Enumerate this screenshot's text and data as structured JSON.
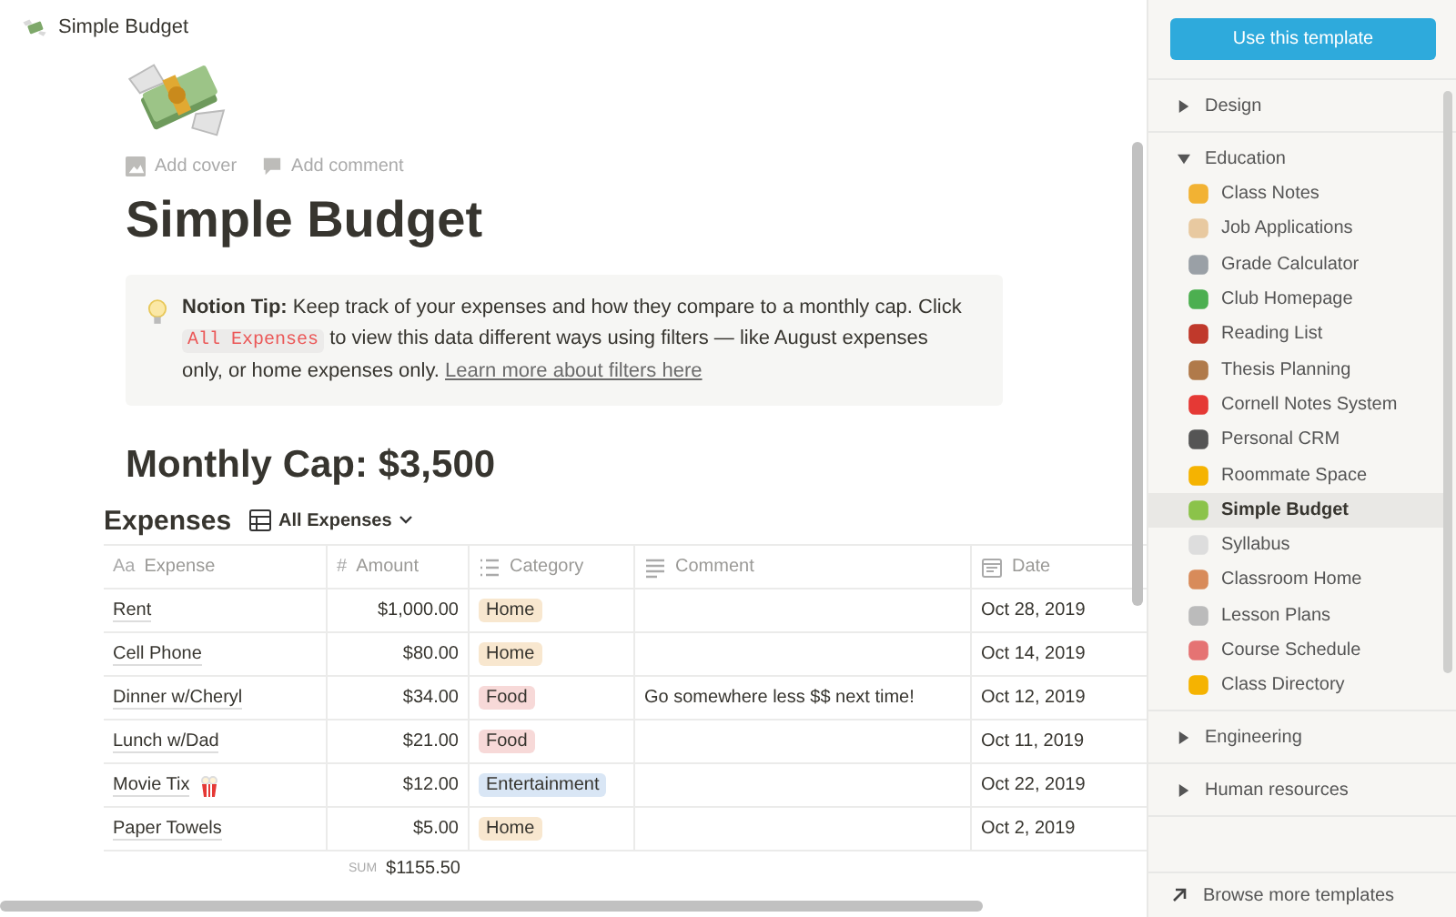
{
  "breadcrumb": {
    "title": "Simple Budget"
  },
  "page_actions": [
    {
      "label": "Add cover",
      "kind": "image"
    },
    {
      "label": "Add comment",
      "kind": "comment"
    }
  ],
  "title": "Simple Budget",
  "callout": {
    "label": "Notion Tip:",
    "text_before": "Keep track of your expenses and how they compare to a monthly cap. Click",
    "code": "All Expenses",
    "text_after": "to view this data different ways using filters — like August expenses only, or home expenses only.",
    "link": "Learn more about filters here"
  },
  "heading": "Monthly Cap: $3,500",
  "database": {
    "title": "Expenses",
    "view": "All Expenses",
    "columns": [
      {
        "label": "Expense",
        "kind": "title",
        "glyph": "Aa"
      },
      {
        "label": "Amount",
        "kind": "number",
        "glyph": "#"
      },
      {
        "label": "Category",
        "kind": "select"
      },
      {
        "label": "Comment",
        "kind": "text"
      },
      {
        "label": "Date",
        "kind": "date"
      }
    ],
    "rows": [
      {
        "expense": "Rent",
        "amount": "$1,000.00",
        "category": "Home",
        "color": "#f8e7cf",
        "comment": "",
        "date": "Oct 28, 2019"
      },
      {
        "expense": "Cell Phone",
        "amount": "$80.00",
        "category": "Home",
        "color": "#f8e7cf",
        "comment": "",
        "date": "Oct 14, 2019"
      },
      {
        "expense": "Dinner w/Cheryl",
        "amount": "$34.00",
        "category": "Food",
        "color": "#f7d9d8",
        "comment": "Go somewhere less $$ next time!",
        "date": "Oct 12, 2019"
      },
      {
        "expense": "Lunch w/Dad",
        "amount": "$21.00",
        "category": "Food",
        "color": "#f7d9d8",
        "comment": "",
        "date": "Oct 11, 2019"
      },
      {
        "expense": "Movie Tix",
        "popcorn": true,
        "amount": "$12.00",
        "category": "Entertainment",
        "color": "#d9e6f5",
        "comment": "",
        "date": "Oct 22, 2019"
      },
      {
        "expense": "Paper Towels",
        "amount": "$5.00",
        "category": "Home",
        "color": "#f8e7cf",
        "comment": "",
        "date": "Oct 2, 2019"
      }
    ],
    "sum_label": "SUM",
    "sum": "$1155.50"
  },
  "sidebar": {
    "button": "Use this template",
    "sections": [
      {
        "label": "Design",
        "expanded": false
      },
      {
        "label": "Education",
        "expanded": true,
        "items": [
          {
            "label": "Class Notes",
            "selected": false
          },
          {
            "label": "Job Applications",
            "selected": false
          },
          {
            "label": "Grade Calculator",
            "selected": false
          },
          {
            "label": "Club Homepage",
            "selected": false
          },
          {
            "label": "Reading List",
            "selected": false
          },
          {
            "label": "Thesis Planning",
            "selected": false
          },
          {
            "label": "Cornell Notes System",
            "selected": false
          },
          {
            "label": "Personal CRM",
            "selected": false
          },
          {
            "label": "Roommate Space",
            "selected": false
          },
          {
            "label": "Simple Budget",
            "selected": true
          },
          {
            "label": "Syllabus",
            "selected": false
          },
          {
            "label": "Classroom Home",
            "selected": false
          },
          {
            "label": "Lesson Plans",
            "selected": false
          },
          {
            "label": "Course Schedule",
            "selected": false
          },
          {
            "label": "Class Directory",
            "selected": false
          }
        ]
      },
      {
        "label": "Engineering",
        "expanded": false
      },
      {
        "label": "Human resources",
        "expanded": false
      }
    ],
    "footer": "Browse more templates"
  }
}
